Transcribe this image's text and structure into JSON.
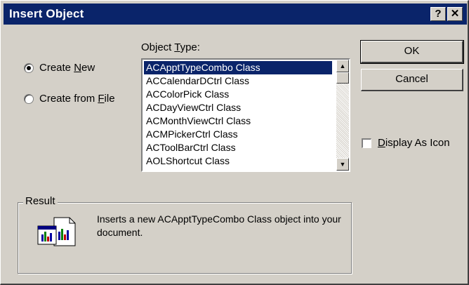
{
  "window": {
    "title": "Insert Object",
    "help_button": "?",
    "close_button": "✕"
  },
  "options": {
    "create_new": {
      "prefix": "Create ",
      "accel": "N",
      "suffix": "ew",
      "selected": true
    },
    "create_from_file": {
      "prefix": "Create from ",
      "accel": "F",
      "suffix": "ile",
      "selected": false
    }
  },
  "object_type": {
    "label_prefix": "Object ",
    "label_accel": "T",
    "label_suffix": "ype:",
    "items": [
      "ACApptTypeCombo Class",
      "ACCalendarDCtrl Class",
      "ACColorPick Class",
      "ACDayViewCtrl Class",
      "ACMonthViewCtrl Class",
      "ACMPickerCtrl Class",
      "ACToolBarCtrl Class",
      "AOLShortcut Class"
    ],
    "selected_index": 0
  },
  "buttons": {
    "ok": "OK",
    "cancel": "Cancel"
  },
  "display_as_icon": {
    "accel": "D",
    "suffix": "isplay As Icon",
    "checked": false
  },
  "result": {
    "label": "Result",
    "text": "Inserts a new ACApptTypeCombo Class object into your document."
  },
  "colors": {
    "titlebar": "#0a246a",
    "face": "#d4d0c8",
    "selection": "#0a246a"
  }
}
